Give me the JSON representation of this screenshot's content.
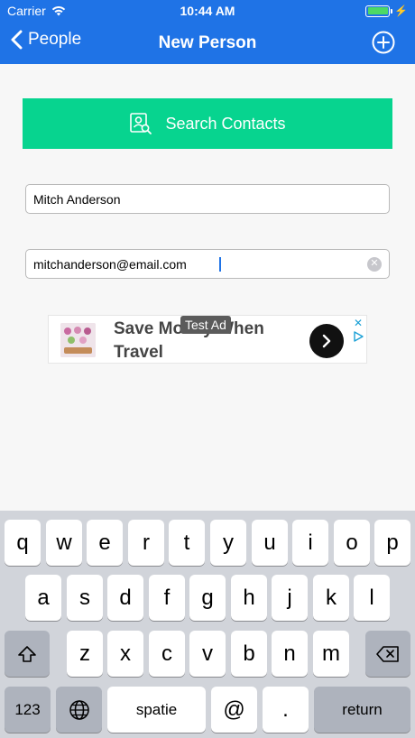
{
  "status_bar": {
    "carrier": "Carrier",
    "time": "10:44 AM"
  },
  "nav": {
    "back_label": "People",
    "title": "New Person"
  },
  "search_button": {
    "label": "Search Contacts"
  },
  "fields": {
    "name_value": "Mitch Anderson",
    "email_value": "mitchanderson@email.com"
  },
  "ad": {
    "headline": "Save Money When Travel",
    "tag": "Test Ad"
  },
  "keyboard": {
    "row1": [
      "q",
      "w",
      "e",
      "r",
      "t",
      "y",
      "u",
      "i",
      "o",
      "p"
    ],
    "row2": [
      "a",
      "s",
      "d",
      "f",
      "g",
      "h",
      "j",
      "k",
      "l"
    ],
    "row3": [
      "z",
      "x",
      "c",
      "v",
      "b",
      "n",
      "m"
    ],
    "numbers_label": "123",
    "space_label": "spatie",
    "at_label": "@",
    "dot_label": ".",
    "return_label": "return"
  },
  "colors": {
    "nav_bar": "#1f73e6",
    "search_button": "#07d48f",
    "keyboard_bg": "#d1d4da"
  }
}
